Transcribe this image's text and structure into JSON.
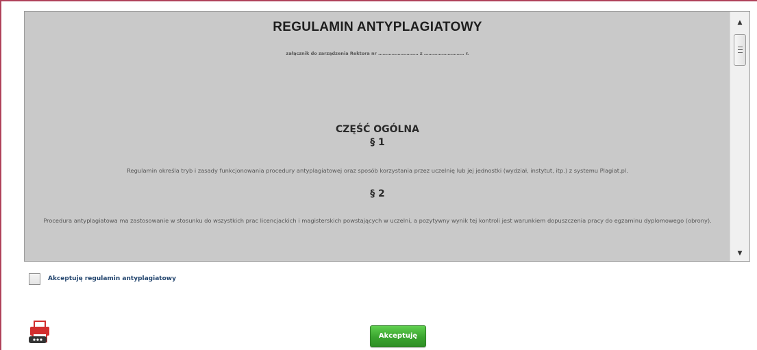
{
  "document": {
    "title": "REGULAMIN ANTYPLAGIATOWY",
    "subtitle": "załącznik do zarządzenia Rektora nr ……………………… z ……………………… r.",
    "section_title": "CZĘŚĆ OGÓLNA",
    "paragraph_1_heading": "§ 1",
    "paragraph_1_text": "Regulamin określa tryb i zasady funkcjonowania procedury antyplagiatowej oraz sposób korzystania przez uczelnię lub jej jednostki (wydział, instytut, itp.) z systemu Plagiat.pl.",
    "paragraph_2_heading": "§ 2",
    "paragraph_2_text": "Procedura antyplagiatowa ma zastosowanie w stosunku do wszystkich prac licencjackich i magisterskich powstających w uczelni, a pozytywny wynik tej kontroli jest warunkiem dopuszczenia pracy do egzaminu dyplomowego (obrony)."
  },
  "scrollbar": {
    "up_arrow_icon": "triangle-up-icon",
    "down_arrow_icon": "triangle-down-icon",
    "up_glyph": "▲",
    "down_glyph": "▼"
  },
  "accept_checkbox": {
    "label": "Akceptuję regulamin antyplagiatowy",
    "checked": false
  },
  "print": {
    "icon": "printer-icon",
    "color": "#d22d2d"
  },
  "accept_button": {
    "label": "Akceptuję",
    "color": "#3aa42f"
  }
}
